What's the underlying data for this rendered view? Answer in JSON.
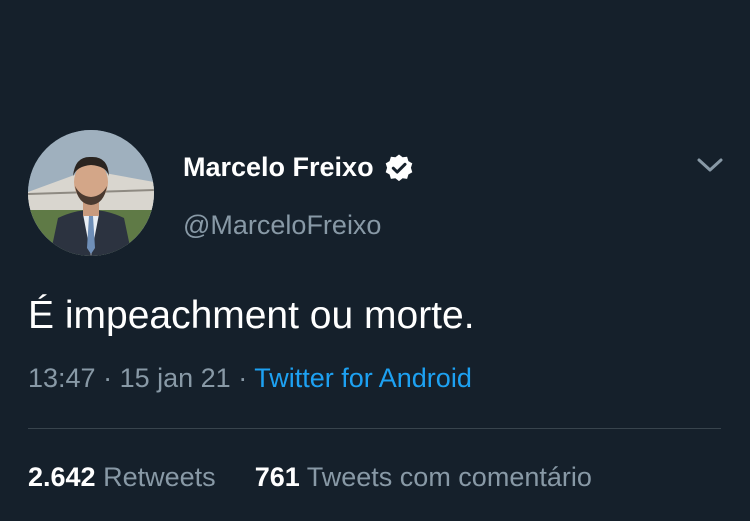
{
  "tweet": {
    "display_name": "Marcelo Freixo",
    "handle": "@MarceloFreixo",
    "text": "É impeachment ou morte.",
    "time": "13:47",
    "separator": "·",
    "date": "15 jan 21",
    "source": "Twitter for Android"
  },
  "stats": {
    "retweets_count": "2.642",
    "retweets_label": "Retweets",
    "quotes_count": "761",
    "quotes_label": "Tweets com comentário"
  },
  "icons": {
    "verified": "verified-badge-icon",
    "menu": "chevron-down-icon"
  },
  "colors": {
    "background": "#15202b",
    "primary_text": "#ffffff",
    "secondary_text": "#8899a6",
    "link": "#1da1f2",
    "divider": "#38444d"
  }
}
